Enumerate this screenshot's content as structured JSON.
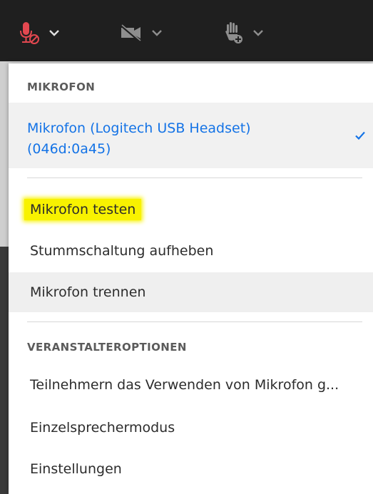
{
  "toolbar": {
    "icons": [
      "microphone-muted-icon",
      "camera-off-icon",
      "raise-hand-icon"
    ],
    "colors": {
      "background": "#1f1f1f",
      "mic_active": "#e34850",
      "icon": "#8e8e8e"
    }
  },
  "menu": {
    "mic_section": {
      "header": "MIKROFON",
      "device_line1": "Mikrofon (Logitech USB Headset)",
      "device_line2": "(046d:0a45)",
      "selected": true
    },
    "actions": [
      {
        "label": "Mikrofon testen",
        "highlighted": true
      },
      {
        "label": "Stummschaltung aufheben"
      },
      {
        "label": "Mikrofon trennen",
        "hovered": true
      }
    ],
    "host_section": {
      "header": "VERANSTALTEROPTIONEN",
      "items": [
        {
          "label": "Teilnehmern das Verwenden von Mikrofon g..."
        },
        {
          "label": "Einzelsprechermodus"
        },
        {
          "label": "Einstellungen"
        }
      ]
    },
    "colors": {
      "accent": "#1473e6",
      "highlight": "#f8f200"
    }
  }
}
